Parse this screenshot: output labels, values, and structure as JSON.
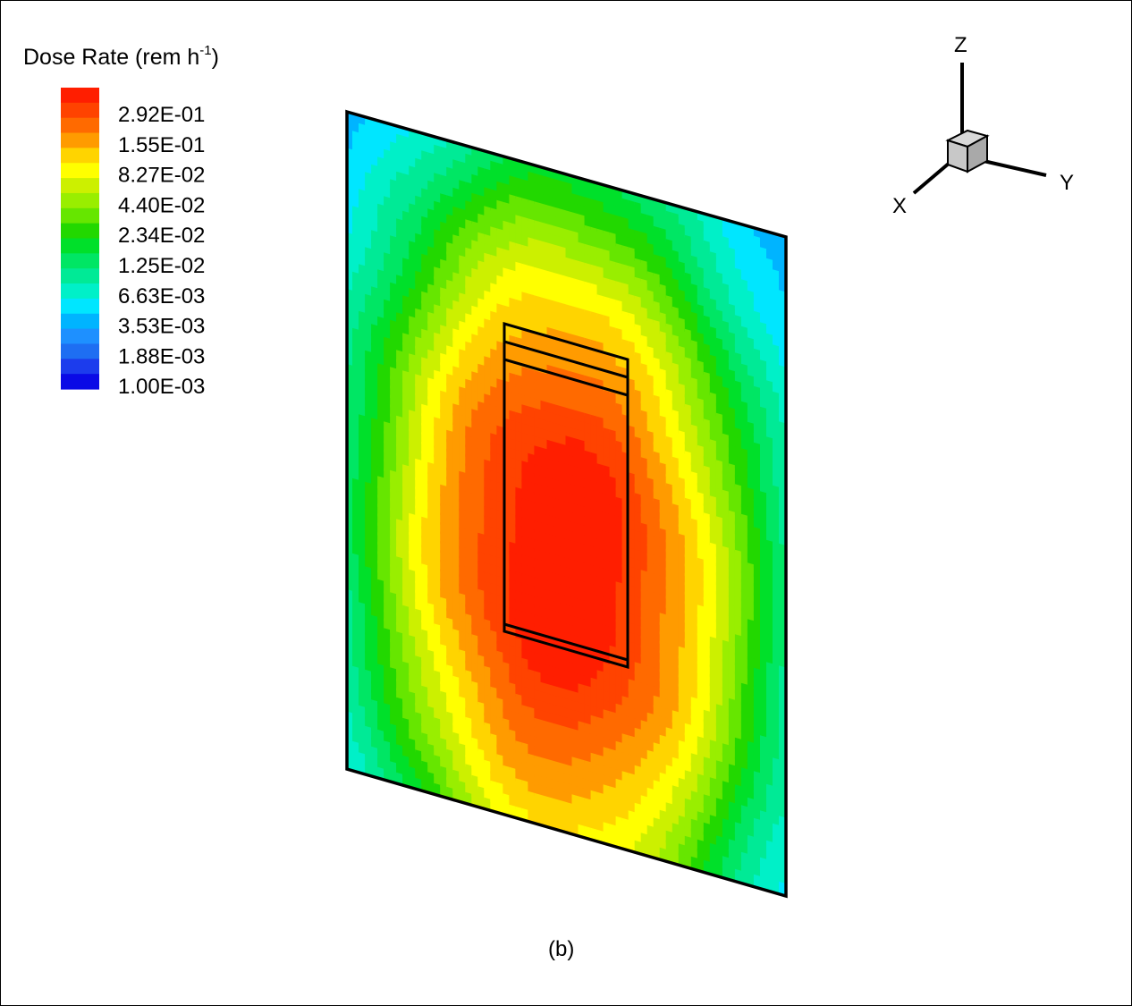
{
  "chart_data": {
    "type": "heatmap",
    "title": "Dose Rate (rem h",
    "title_sup": "-1",
    "title_close": ")",
    "caption": "(b)",
    "legend": {
      "labels": [
        "2.92E-01",
        "1.55E-01",
        "8.27E-02",
        "4.40E-02",
        "2.34E-02",
        "1.25E-02",
        "6.63E-03",
        "3.53E-03",
        "1.88E-03",
        "1.00E-03"
      ],
      "levels": [
        0.001,
        0.00137,
        0.00188,
        0.00258,
        0.00353,
        0.00484,
        0.00663,
        0.00909,
        0.0125,
        0.0171,
        0.0234,
        0.0321,
        0.044,
        0.0604,
        0.0827,
        0.113,
        0.155,
        0.213,
        0.292,
        0.4,
        0.55
      ],
      "colors": [
        "#0a0ae6",
        "#1c3ced",
        "#1e6ef2",
        "#1e90ff",
        "#00b4ff",
        "#00e6ff",
        "#00f0c8",
        "#00ea96",
        "#00e664",
        "#00e02a",
        "#22d800",
        "#66e600",
        "#99ee00",
        "#ccf000",
        "#ffff00",
        "#ffd400",
        "#ff9b00",
        "#ff6a00",
        "#ff4300",
        "#ff1e00"
      ]
    },
    "axes_triad": {
      "z": "Z",
      "y": "Y",
      "x": "X"
    },
    "field": {
      "peak": 0.55,
      "center": [
        0.495,
        0.595
      ],
      "sigma_x": 0.17,
      "sigma_z": 0.22,
      "min_value": 0.0009
    }
  }
}
